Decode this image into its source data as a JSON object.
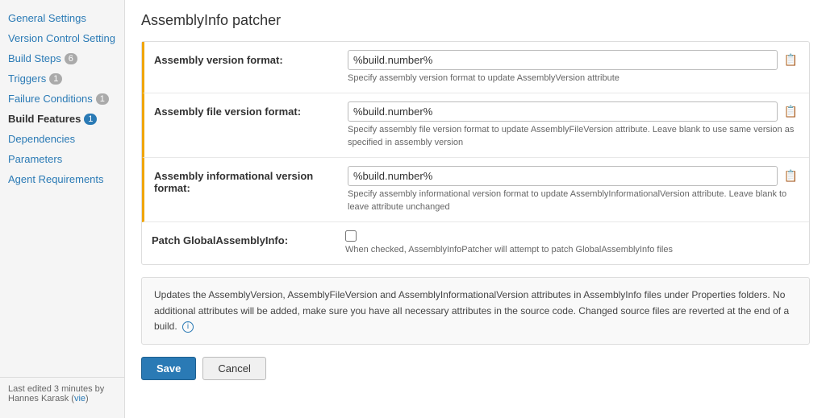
{
  "sidebar": {
    "items": [
      {
        "id": "general-settings",
        "label": "General Settings",
        "badge": null,
        "active": false
      },
      {
        "id": "version-control-settings",
        "label": "Version Control Setting",
        "badge": null,
        "active": false
      },
      {
        "id": "build-steps",
        "label": "Build Steps",
        "badge": "6",
        "active": false
      },
      {
        "id": "triggers",
        "label": "Triggers",
        "badge": "1",
        "active": false
      },
      {
        "id": "failure-conditions",
        "label": "Failure Conditions",
        "badge": "1",
        "active": false
      },
      {
        "id": "build-features",
        "label": "Build Features",
        "badge": "1",
        "active": true
      },
      {
        "id": "dependencies",
        "label": "Dependencies",
        "badge": null,
        "active": false
      },
      {
        "id": "parameters",
        "label": "Parameters",
        "badge": null,
        "active": false
      },
      {
        "id": "agent-requirements",
        "label": "Agent Requirements",
        "badge": null,
        "active": false
      }
    ],
    "footer": {
      "last_edited_prefix": "Last edited",
      "time_ago": "3 minutes",
      "by_prefix": "by",
      "author": "Hannes Karask",
      "view_link": "vie"
    }
  },
  "page": {
    "title": "AssemblyInfo patcher",
    "fields": [
      {
        "id": "assembly-version-format",
        "label": "Assembly version format:",
        "value": "%build.number%",
        "hint": "Specify assembly version format to update AssemblyVersion attribute",
        "type": "text",
        "has_border": true
      },
      {
        "id": "assembly-file-version-format",
        "label": "Assembly file version format:",
        "value": "%build.number%",
        "hint": "Specify assembly file version format to update AssemblyFileVersion attribute. Leave blank to use same version as specified in assembly version",
        "type": "text",
        "has_border": true
      },
      {
        "id": "assembly-informational-version-format",
        "label": "Assembly informational version format:",
        "value": "%build.number%",
        "hint": "Specify assembly informational version format to update AssemblyInformationalVersion attribute. Leave blank to leave attribute unchanged",
        "type": "text",
        "has_border": true
      },
      {
        "id": "patch-global-assembly-info",
        "label": "Patch GlobalAssemblyInfo:",
        "hint": "When checked, AssemblyInfoPatcher will attempt to patch GlobalAssemblyInfo files",
        "type": "checkbox",
        "checked": false,
        "has_border": false
      }
    ],
    "description": "Updates the AssemblyVersion, AssemblyFileVersion and AssemblyInformationalVersion attributes in AssemblyInfo files under Properties folders. No additional attributes will be added, make sure you have all necessary attributes in the source code. Changed source files are reverted at the end of a build.",
    "buttons": {
      "save": "Save",
      "cancel": "Cancel"
    }
  }
}
